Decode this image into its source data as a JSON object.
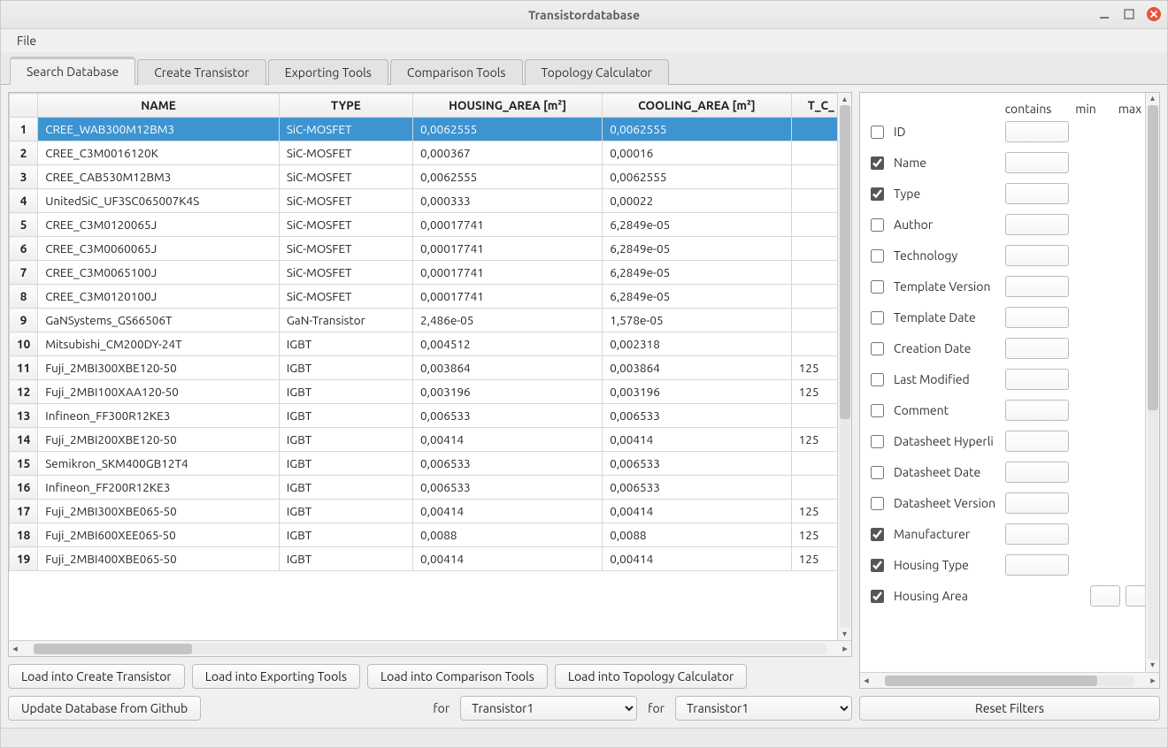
{
  "window": {
    "title": "Transistordatabase"
  },
  "menu": {
    "file": "File"
  },
  "tabs": [
    {
      "label": "Search Database",
      "active": true
    },
    {
      "label": "Create Transistor",
      "active": false
    },
    {
      "label": "Exporting Tools",
      "active": false
    },
    {
      "label": "Comparison Tools",
      "active": false
    },
    {
      "label": "Topology Calculator",
      "active": false
    }
  ],
  "table": {
    "headers": [
      "NAME",
      "TYPE",
      "HOUSING_AREA [m²]",
      "COOLING_AREA [m²]",
      "T_C_"
    ],
    "rows": [
      {
        "n": 1,
        "selected": true,
        "cells": [
          "CREE_WAB300M12BM3",
          "SiC-MOSFET",
          "0,0062555",
          "0,0062555",
          ""
        ]
      },
      {
        "n": 2,
        "selected": false,
        "cells": [
          "CREE_C3M0016120K",
          "SiC-MOSFET",
          "0,000367",
          "0,00016",
          ""
        ]
      },
      {
        "n": 3,
        "selected": false,
        "cells": [
          "CREE_CAB530M12BM3",
          "SiC-MOSFET",
          "0,0062555",
          "0,0062555",
          ""
        ]
      },
      {
        "n": 4,
        "selected": false,
        "cells": [
          "UnitedSiC_UF3SC065007K4S",
          "SiC-MOSFET",
          "0,000333",
          "0,00022",
          ""
        ]
      },
      {
        "n": 5,
        "selected": false,
        "cells": [
          "CREE_C3M0120065J",
          "SiC-MOSFET",
          "0,00017741",
          "6,2849e-05",
          ""
        ]
      },
      {
        "n": 6,
        "selected": false,
        "cells": [
          "CREE_C3M0060065J",
          "SiC-MOSFET",
          "0,00017741",
          "6,2849e-05",
          ""
        ]
      },
      {
        "n": 7,
        "selected": false,
        "cells": [
          "CREE_C3M0065100J",
          "SiC-MOSFET",
          "0,00017741",
          "6,2849e-05",
          ""
        ]
      },
      {
        "n": 8,
        "selected": false,
        "cells": [
          "CREE_C3M0120100J",
          "SiC-MOSFET",
          "0,00017741",
          "6,2849e-05",
          ""
        ]
      },
      {
        "n": 9,
        "selected": false,
        "cells": [
          "GaNSystems_GS66506T",
          "GaN-Transistor",
          "2,486e-05",
          "1,578e-05",
          ""
        ]
      },
      {
        "n": 10,
        "selected": false,
        "cells": [
          "Mitsubishi_CM200DY-24T",
          "IGBT",
          "0,004512",
          "0,002318",
          ""
        ]
      },
      {
        "n": 11,
        "selected": false,
        "cells": [
          "Fuji_2MBI300XBE120-50",
          "IGBT",
          "0,003864",
          "0,003864",
          "125"
        ]
      },
      {
        "n": 12,
        "selected": false,
        "cells": [
          "Fuji_2MBI100XAA120-50",
          "IGBT",
          "0,003196",
          "0,003196",
          "125"
        ]
      },
      {
        "n": 13,
        "selected": false,
        "cells": [
          "Infineon_FF300R12KE3",
          "IGBT",
          "0,006533",
          "0,006533",
          ""
        ]
      },
      {
        "n": 14,
        "selected": false,
        "cells": [
          "Fuji_2MBI200XBE120-50",
          "IGBT",
          "0,00414",
          "0,00414",
          "125"
        ]
      },
      {
        "n": 15,
        "selected": false,
        "cells": [
          "Semikron_SKM400GB12T4",
          "IGBT",
          "0,006533",
          "0,006533",
          ""
        ]
      },
      {
        "n": 16,
        "selected": false,
        "cells": [
          "Infineon_FF200R12KE3",
          "IGBT",
          "0,006533",
          "0,006533",
          ""
        ]
      },
      {
        "n": 17,
        "selected": false,
        "cells": [
          "Fuji_2MBI300XBE065-50",
          "IGBT",
          "0,00414",
          "0,00414",
          "125"
        ]
      },
      {
        "n": 18,
        "selected": false,
        "cells": [
          "Fuji_2MBI600XEE065-50",
          "IGBT",
          "0,0088",
          "0,0088",
          "125"
        ]
      },
      {
        "n": 19,
        "selected": false,
        "cells": [
          "Fuji_2MBI400XBE065-50",
          "IGBT",
          "0,00414",
          "0,00414",
          "125"
        ]
      }
    ]
  },
  "buttons": {
    "load_create": "Load into Create Transistor",
    "load_export": "Load into Exporting Tools",
    "load_compare": "Load into Comparison Tools",
    "load_topology": "Load into Topology Calculator",
    "update_db": "Update Database from Github",
    "for1": "for",
    "for2": "for",
    "combo1": "Transistor1",
    "combo2": "Transistor1",
    "reset": "Reset Filters"
  },
  "filters": {
    "header": {
      "contains": "contains",
      "min": "min",
      "max": "max"
    },
    "rows": [
      {
        "label": "ID",
        "checked": false,
        "numeric": false
      },
      {
        "label": "Name",
        "checked": true,
        "numeric": false
      },
      {
        "label": "Type",
        "checked": true,
        "numeric": false
      },
      {
        "label": "Author",
        "checked": false,
        "numeric": false
      },
      {
        "label": "Technology",
        "checked": false,
        "numeric": false
      },
      {
        "label": "Template Version",
        "checked": false,
        "numeric": false
      },
      {
        "label": "Template Date",
        "checked": false,
        "numeric": false
      },
      {
        "label": "Creation Date",
        "checked": false,
        "numeric": false
      },
      {
        "label": "Last Modified",
        "checked": false,
        "numeric": false
      },
      {
        "label": "Comment",
        "checked": false,
        "numeric": false
      },
      {
        "label": "Datasheet Hyperli",
        "checked": false,
        "numeric": false
      },
      {
        "label": "Datasheet Date",
        "checked": false,
        "numeric": false
      },
      {
        "label": "Datasheet Version",
        "checked": false,
        "numeric": false
      },
      {
        "label": "Manufacturer",
        "checked": true,
        "numeric": false
      },
      {
        "label": "Housing Type",
        "checked": true,
        "numeric": false
      },
      {
        "label": "Housing Area",
        "checked": true,
        "numeric": true
      }
    ]
  }
}
